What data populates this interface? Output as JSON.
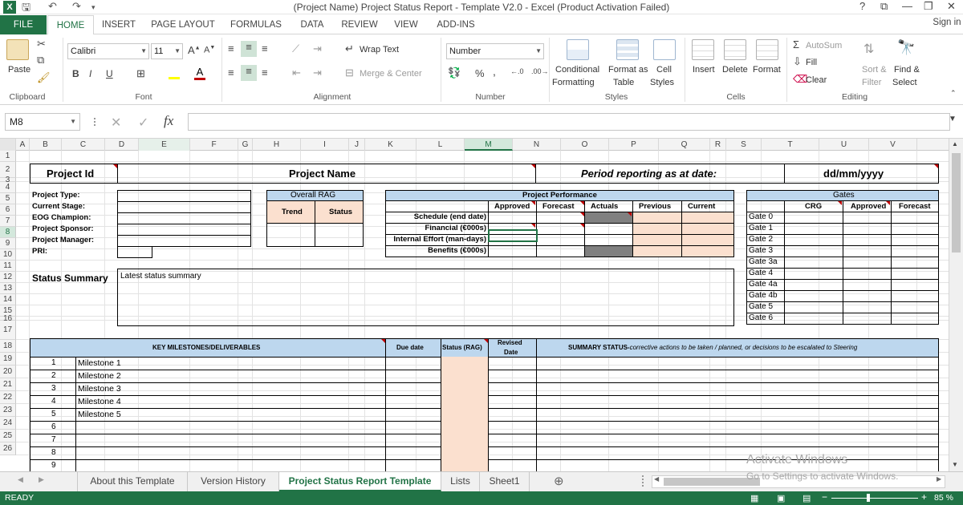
{
  "window": {
    "title": "(Project Name) Project Status Report - Template V2.0 - Excel (Product Activation Failed)",
    "help": "?",
    "controls": [
      "⧉",
      "—",
      "❐",
      "✕"
    ],
    "signin": "Sign in"
  },
  "ribbon": {
    "tabs": [
      "FILE",
      "HOME",
      "INSERT",
      "PAGE LAYOUT",
      "FORMULAS",
      "DATA",
      "REVIEW",
      "VIEW",
      "ADD-INS"
    ],
    "clipboard": {
      "paste": "Paste",
      "label": "Clipboard"
    },
    "font": {
      "name": "Calibri",
      "size": "11",
      "label": "Font",
      "bold": "B",
      "italic": "I",
      "underline": "U"
    },
    "alignment": {
      "wrap": "Wrap Text",
      "merge": "Merge & Center",
      "label": "Alignment"
    },
    "number": {
      "format": "Number",
      "label": "Number",
      "percent": "%",
      "comma": ","
    },
    "styles": {
      "conditional": [
        "Conditional",
        "Formatting"
      ],
      "formattable": [
        "Format as",
        "Table"
      ],
      "cell": [
        "Cell",
        "Styles"
      ],
      "label": "Styles"
    },
    "cells": {
      "insert": "Insert",
      "delete": "Delete",
      "format": "Format",
      "label": "Cells"
    },
    "editing": {
      "autosum": "AutoSum",
      "fill": "Fill",
      "clear": "Clear",
      "sort": [
        "Sort &",
        "Filter"
      ],
      "find": [
        "Find &",
        "Select"
      ],
      "label": "Editing"
    }
  },
  "formula_bar": {
    "name_box": "M8",
    "fx": "fx",
    "value": ""
  },
  "columns": [
    "A",
    "B",
    "C",
    "D",
    "E",
    "F",
    "G",
    "H",
    "I",
    "J",
    "K",
    "L",
    "M",
    "N",
    "O",
    "P",
    "Q",
    "R",
    "S",
    "T",
    "U",
    "V"
  ],
  "rows": [
    "1",
    "2",
    "3",
    "4",
    "5",
    "6",
    "7",
    "8",
    "9",
    "10",
    "11",
    "12",
    "13",
    "14",
    "15",
    "16",
    "17",
    "18",
    "19",
    "20",
    "21",
    "22",
    "23",
    "24",
    "25",
    "26"
  ],
  "sheet": {
    "project_id": "Project Id",
    "project_name": "Project Name",
    "period_label": "Period reporting as at date:",
    "date": "dd/mm/yyyy",
    "info_labels": [
      "Project Type:",
      "Current Stage:",
      "EOG Champion:",
      "Project Sponsor:",
      "Project Manager:",
      "PRI:"
    ],
    "rag": {
      "title": "Overall RAG",
      "trend": "Trend",
      "status": "Status"
    },
    "performance": {
      "title": "Project Performance",
      "headers": [
        "Approved",
        "Forecast",
        "Actuals",
        "Previous",
        "Current"
      ],
      "rows": [
        "Schedule (end date)",
        "Financial (€000s)",
        "Internal Effort (man-days)",
        "Benefits (€000s)"
      ]
    },
    "gates": {
      "title": "Gates",
      "headers": [
        "CRG",
        "Approved",
        "Forecast"
      ],
      "rows": [
        "Gate 0",
        "Gate 1",
        "Gate 2",
        "Gate 3",
        "Gate 3a",
        "Gate 4",
        "Gate 4a",
        "Gate 4b",
        "Gate 5",
        "Gate 6"
      ]
    },
    "status_summary": {
      "label": "Status Summary",
      "value": "Latest status summary"
    },
    "milestones": {
      "title": "KEY MILESTONES/DELIVERABLES",
      "due": "Due date",
      "status": "Status (RAG)",
      "revised": [
        "Revised",
        "Date"
      ],
      "summary_bold": "SUMMARY STATUS-",
      "summary_italic": "corrective actions to be taken / planned, or decisions to be escalated to Steering",
      "numbers": [
        "1",
        "2",
        "3",
        "4",
        "5",
        "6",
        "7",
        "8",
        "9"
      ],
      "names": [
        "Milestone 1",
        "Milestone 2",
        "Milestone 3",
        "Milestone 4",
        "Milestone 5",
        "",
        "",
        "",
        ""
      ]
    }
  },
  "sheet_tabs": [
    "About this Template",
    "Version History",
    "Project Status Report Template",
    "Lists",
    "Sheet1"
  ],
  "status": {
    "ready": "READY",
    "zoom": "85 %"
  },
  "watermark": {
    "line1": "Activate Windows",
    "line2": "Go to Settings to activate Windows."
  },
  "colors": {
    "excel_green": "#217346",
    "header_blue": "#bdd7ee",
    "peach": "#fbe0cf",
    "dark_gray": "#808080"
  }
}
